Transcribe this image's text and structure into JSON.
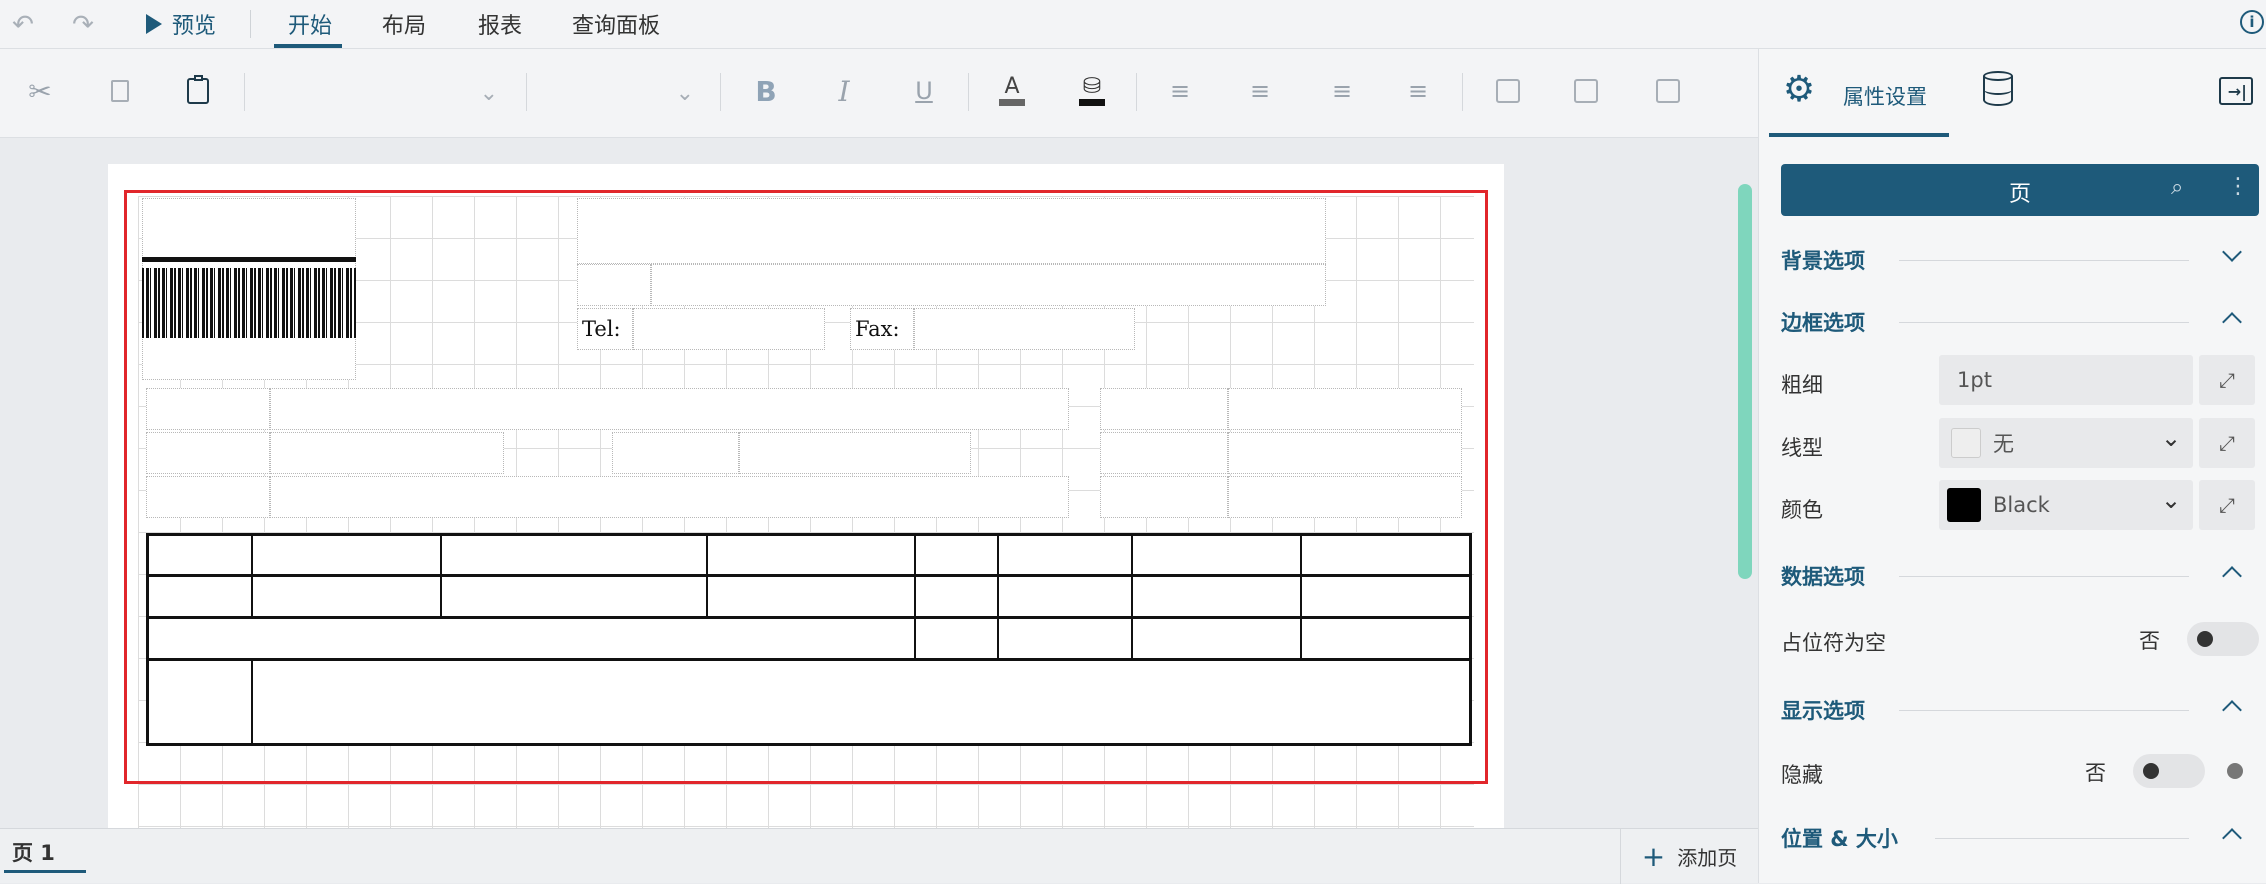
{
  "menubar": {
    "preview": "预览",
    "tabs": [
      "开始",
      "布局",
      "报表",
      "查询面板"
    ],
    "active_tab": "开始"
  },
  "toolbar": {
    "bold": "B",
    "italic": "I",
    "underline": "U"
  },
  "report": {
    "tel_label": "Tel:",
    "fax_label": "Fax:"
  },
  "statusbar": {
    "page_tab": "页 1",
    "add_page": "添加页"
  },
  "panel": {
    "tab_properties": "属性设置",
    "header_title": "页",
    "sections": {
      "background": "背景选项",
      "border": "边框选项",
      "data": "数据选项",
      "display": "显示选项",
      "position": "位置 & 大小"
    },
    "border": {
      "width_label": "粗细",
      "width_value": "1pt",
      "style_label": "线型",
      "style_value": "无",
      "color_label": "颜色",
      "color_value": "Black",
      "color_swatch": "#000000"
    },
    "data": {
      "placeholder_empty_label": "占位符为空",
      "placeholder_empty_value": "否"
    },
    "display": {
      "hidden_label": "隐藏",
      "hidden_value": "否"
    }
  },
  "colors": {
    "accent": "#1e5a7a",
    "selection": "#e1262b",
    "scrollbar": "#7fd6bd"
  }
}
